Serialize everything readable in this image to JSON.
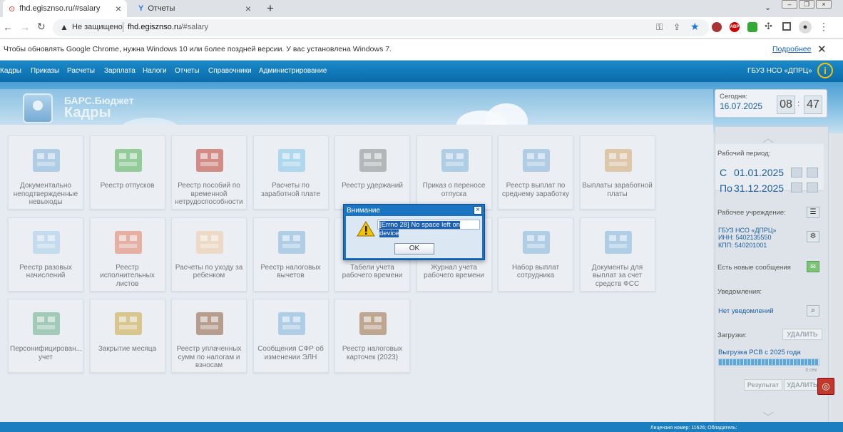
{
  "browser": {
    "tabs": [
      {
        "title": "fhd.egisznso.ru/#salary",
        "close": "×"
      },
      {
        "title": "Отчеты",
        "close": "×"
      }
    ],
    "new_tab": "+",
    "window_controls": [
      "–",
      "❐",
      "×"
    ],
    "security_label": "Не защищено",
    "url_domain": "fhd.egisznso.ru",
    "url_path": "/#salary",
    "infobar_text": "Чтобы обновлять Google Chrome, нужна Windows 10 или более поздней версии. У вас установлена Windows 7.",
    "infobar_link": "Подробнее"
  },
  "app": {
    "menu": [
      "Кадры",
      "Приказы",
      "Расчеты",
      "Зарплата",
      "Налоги",
      "Отчеты",
      "Справочники",
      "Администрирование"
    ],
    "org_name": "ГБУЗ НСО «ДПРЦ»",
    "logo_line1": "БАРС.Бюджет",
    "logo_line2": "Кадры",
    "today_label": "Сегодня:",
    "today_date": "16.07.2025",
    "time_h": "08",
    "time_sep": ":",
    "time_m": "47",
    "tiles": [
      {
        "label": "Документально неподтвержденные невыходы",
        "icon": "building-icon"
      },
      {
        "label": "Реестр отпусков",
        "icon": "palm-icon"
      },
      {
        "label": "Реестр пособий по временной нетрудоспособности",
        "icon": "thermometer-icon"
      },
      {
        "label": "Расчеты по заработной плате",
        "icon": "calculator-icon"
      },
      {
        "label": "Реестр удержаний",
        "icon": "safe-icon"
      },
      {
        "label": "Приказ о переносе отпуска",
        "icon": "building-icon"
      },
      {
        "label": "Реестр выплат по среднему заработку",
        "icon": "building-icon"
      },
      {
        "label": "Выплаты заработной платы",
        "icon": "person-icon"
      },
      {
        "label": "Реестр разовых начислений",
        "icon": "gift-icon"
      },
      {
        "label": "Реестр исполнительных листов",
        "icon": "document-icon"
      },
      {
        "label": "Расчеты по уходу за ребенком",
        "icon": "baby-icon"
      },
      {
        "label": "Реестр налоговых вычетов",
        "icon": "building-icon"
      },
      {
        "label": "Табели учета рабочего времени",
        "icon": "building-icon"
      },
      {
        "label": "Журнал учета рабочего времени",
        "icon": "building-icon"
      },
      {
        "label": "Набор выплат сотрудника",
        "icon": "building-icon"
      },
      {
        "label": "Документы для выплат за счет средств ФСС",
        "icon": "building-icon"
      },
      {
        "label": "Персонифицирован... учет",
        "icon": "accountant-icon"
      },
      {
        "label": "Закрытие месяца",
        "icon": "lock-icon"
      },
      {
        "label": "Реестр уплаченных сумм по налогам и взносам",
        "icon": "folder-icon"
      },
      {
        "label": "Сообщения СФР об изменении ЭЛН",
        "icon": "building-icon"
      },
      {
        "label": "Реестр налоговых карточек (2023)",
        "icon": "wallet-icon"
      }
    ],
    "sidebar": {
      "period_label": "Рабочий период:",
      "from_prefix": "С",
      "from_date": "01.01.2025",
      "to_prefix": "По",
      "to_date": "31.12.2025",
      "institution_label": "Рабочее учреждение:",
      "institution_name": "ГБУЗ НСО «ДПРЦ»",
      "inn": "ИНН: 5402135550",
      "kpp": "КПП: 540201001",
      "messages_label": "Есть новые сообщения",
      "notifications_label": "Уведомления:",
      "notifications_value": "Нет уведомлений",
      "downloads_label": "Загрузки:",
      "delete_label": "УДАЛИТЬ",
      "download_item": "Выгрузка РСВ с 2025 года",
      "download_progress": 1.0,
      "download_time": "3 сек",
      "result_label": "Результат",
      "delete_label2": "УДАЛИТЬ"
    },
    "footer_text": "Лицензия номер: 11626; Обладатель:"
  },
  "dialog": {
    "title": "Внимание",
    "message": "[Errno 28] No space left on device",
    "ok_label": "OK",
    "close": "×"
  }
}
